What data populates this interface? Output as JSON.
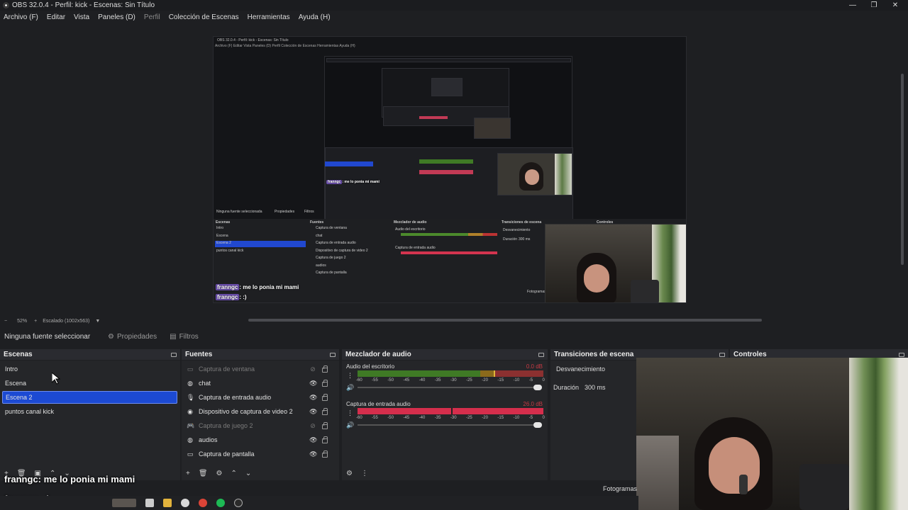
{
  "window": {
    "title": "OBS 32.0.4 - Perfil: kick - Escenas: Sin Título"
  },
  "menu": [
    {
      "label": "Archivo (F)",
      "dim": false
    },
    {
      "label": "Editar",
      "dim": false
    },
    {
      "label": "Vista",
      "dim": false
    },
    {
      "label": "Paneles (D)",
      "dim": false
    },
    {
      "label": "Perfil",
      "dim": true
    },
    {
      "label": "Colección de Escenas",
      "dim": false
    },
    {
      "label": "Herramientas",
      "dim": false
    },
    {
      "label": "Ayuda (H)",
      "dim": false
    }
  ],
  "preview": {
    "inner_title": "OBS 32.0.4 - Perfil: kick - Escenas: Sin Título",
    "inner_menu": "Archivo (F)    Editar    Vista    Paneles (D)    Perfil    Colección de Escenas    Herramientas    Ayuda (H)",
    "inner_nosel": "Ninguna fuente seleccionada",
    "inner_props": "Propiedades",
    "inner_filters": "Filtros",
    "inner_scenes_title": "Escenas",
    "inner_sources_title": "Fuentes",
    "inner_mixer_title": "Mezclador de audio",
    "inner_trans_title": "Transiciones de escena",
    "inner_controls_title": "Controles",
    "inner_scenes": [
      "Intro",
      "Escena",
      "Escena 2",
      "puntos canal kick"
    ],
    "inner_sources": [
      "Captura de ventana",
      "chat",
      "Captura de entrada audio",
      "Dispositivo de captura de video 2",
      "Captura de juego 2",
      "audios",
      "Captura de pantalla"
    ],
    "inner_mixer_ch1": "Audio del escritorio",
    "inner_mixer_ch2": "Captura de entrada audio",
    "inner_trans": "Desvanecimiento",
    "inner_duration": "Duración",
    "inner_duration_val": "300 ms",
    "inner_frames": "Fotogramas",
    "chat_line1_name": "franngc",
    "chat_line1_text": ": me lo ponia mi mami",
    "chat_line2_name": "franngc",
    "chat_line2_text": ": :)"
  },
  "zoom": {
    "minus": "−",
    "percent": "52%",
    "plus": "+",
    "scaled": "Escalado (1002x563)",
    "arrow": "▼"
  },
  "source_bar": {
    "no_selection": "Ninguna fuente seleccionar",
    "properties": "Propiedades",
    "filters": "Filtros"
  },
  "scenes": {
    "title": "Escenas",
    "items": [
      {
        "label": "Intro",
        "selected": false
      },
      {
        "label": "Escena",
        "selected": false
      },
      {
        "label": "Escena 2",
        "selected": true
      },
      {
        "label": "puntos canal kick",
        "selected": false
      }
    ]
  },
  "sources": {
    "title": "Fuentes",
    "items": [
      {
        "label": "Captura de ventana",
        "icon": "window-icon",
        "visible": false
      },
      {
        "label": "chat",
        "icon": "globe-icon",
        "visible": true
      },
      {
        "label": "Captura de entrada audio",
        "icon": "microphone-icon",
        "visible": true
      },
      {
        "label": "Dispositivo de captura de video 2",
        "icon": "camera-icon",
        "visible": true
      },
      {
        "label": "Captura de juego 2",
        "icon": "gamepad-icon",
        "visible": false
      },
      {
        "label": "audios",
        "icon": "globe-icon",
        "visible": true
      },
      {
        "label": "Captura de pantalla",
        "icon": "monitor-icon",
        "visible": true
      }
    ]
  },
  "mixer": {
    "title": "Mezclador de audio",
    "channels": [
      {
        "name": "Audio del escritorio",
        "db": "0.0 dB",
        "level": 0.0
      },
      {
        "name": "Captura de entrada audio",
        "db": "26.0 dB",
        "level": 1.0
      }
    ],
    "scale": [
      "-60",
      "-55",
      "-50",
      "-45",
      "-40",
      "-35",
      "-30",
      "-25",
      "-20",
      "-15",
      "-10",
      "-5",
      "0"
    ]
  },
  "transitions": {
    "title": "Transiciones de escena",
    "selected": "Desvanecimiento",
    "duration_label": "Duración",
    "duration_value": "300 ms"
  },
  "controls": {
    "title": "Controles",
    "frames_label": "Fotogramas"
  },
  "chat_overlay": {
    "line1_name": "franngc",
    "line1_text": ": me lo ponia mi mami",
    "line2_name": "franngc",
    "line2_text": ": :)"
  },
  "colors": {
    "selection": "#1c4ad3",
    "panel": "#252629",
    "background": "#1e1f22",
    "meter_red": "#d52e4c"
  }
}
